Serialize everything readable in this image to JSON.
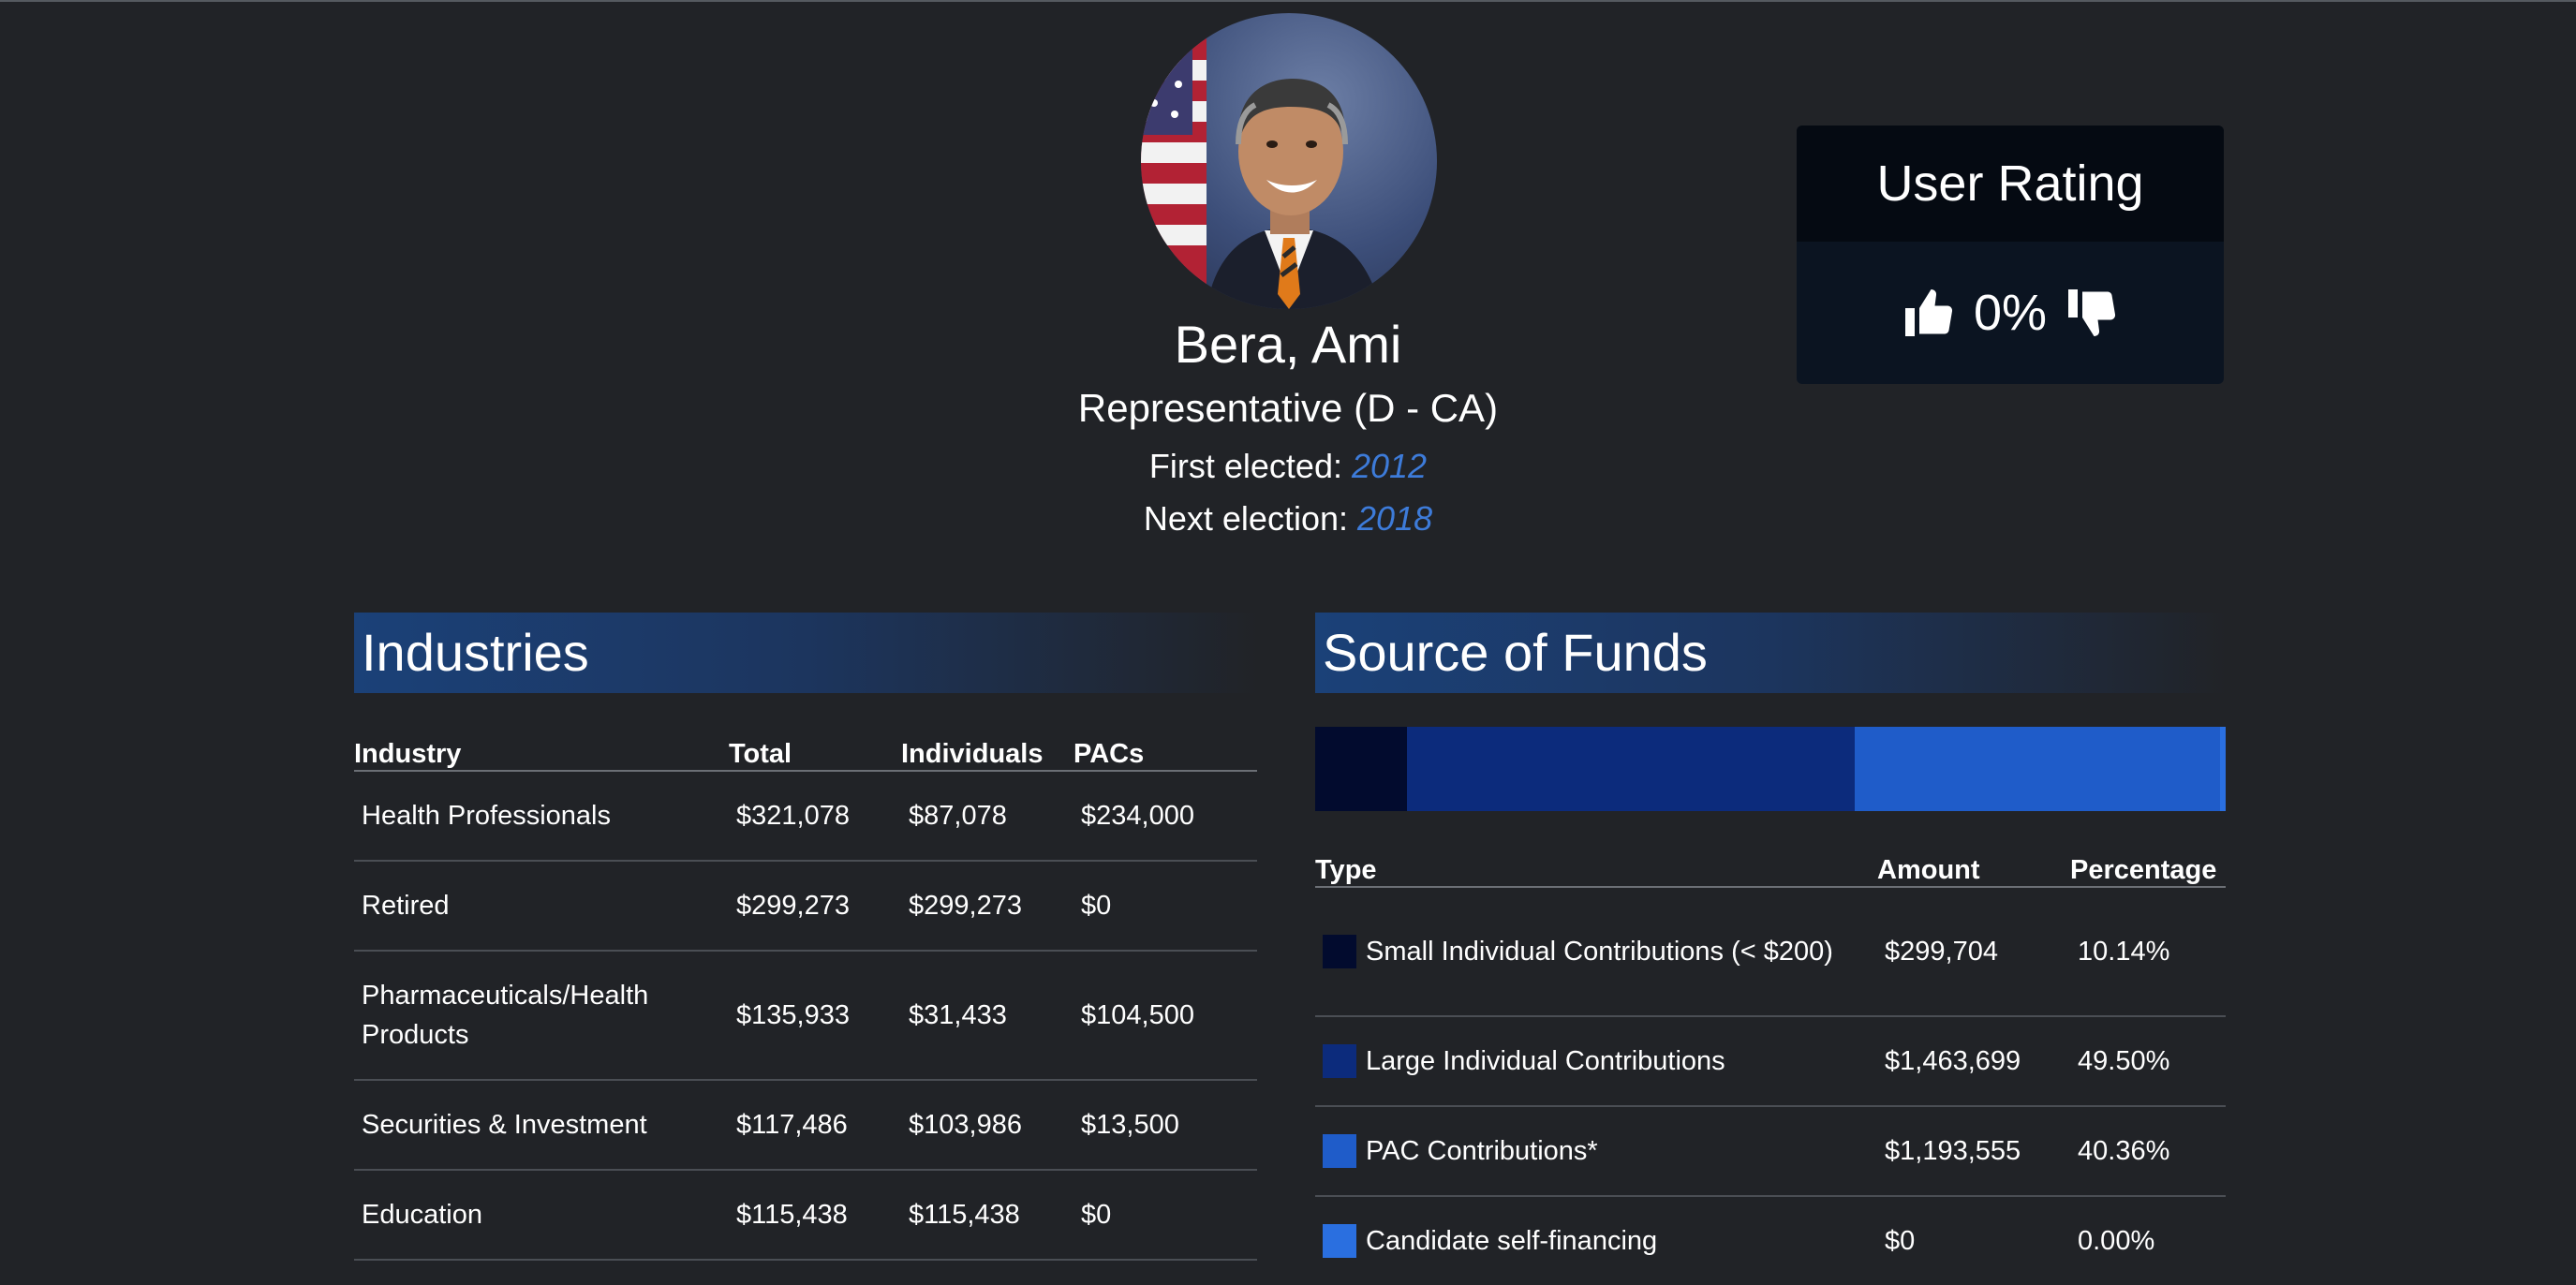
{
  "profile": {
    "name": "Bera, Ami",
    "role": "Representative (D - CA)",
    "first_elected_label": "First elected: ",
    "first_elected_year": "2012",
    "next_election_label": "Next election: ",
    "next_election_year": "2018"
  },
  "rating": {
    "title": "User Rating",
    "value": "0%",
    "thumbs_up_icon": "thumbs-up-icon",
    "thumbs_down_icon": "thumbs-down-icon"
  },
  "industries": {
    "title": "Industries",
    "columns": [
      "Industry",
      "Total",
      "Individuals",
      "PACs"
    ],
    "rows": [
      {
        "industry": "Health Professionals",
        "total": "$321,078",
        "individuals": "$87,078",
        "pacs": "$234,000"
      },
      {
        "industry": "Retired",
        "total": "$299,273",
        "individuals": "$299,273",
        "pacs": "$0"
      },
      {
        "industry": "Pharmaceuticals/Health Products",
        "total": "$135,933",
        "individuals": "$31,433",
        "pacs": "$104,500"
      },
      {
        "industry": "Securities & Investment",
        "total": "$117,486",
        "individuals": "$103,986",
        "pacs": "$13,500"
      },
      {
        "industry": "Education",
        "total": "$115,438",
        "individuals": "$115,438",
        "pacs": "$0"
      }
    ]
  },
  "funds": {
    "title": "Source of Funds",
    "columns": [
      "Type",
      "Amount",
      "Percentage"
    ],
    "rows": [
      {
        "type": "Small Individual Contributions (< $200)",
        "amount": "$299,704",
        "percentage": "10.14%",
        "color": "#020b2e"
      },
      {
        "type": "Large Individual Contributions",
        "amount": "$1,463,699",
        "percentage": "49.50%",
        "color": "#0c2b7c"
      },
      {
        "type": "PAC Contributions*",
        "amount": "$1,193,555",
        "percentage": "40.36%",
        "color": "#1f5cc9"
      },
      {
        "type": "Candidate self-financing",
        "amount": "$0",
        "percentage": "0.00%",
        "color": "#2a6fe0"
      }
    ],
    "bar_shares": [
      10.14,
      49.5,
      40.36,
      0.0
    ]
  }
}
